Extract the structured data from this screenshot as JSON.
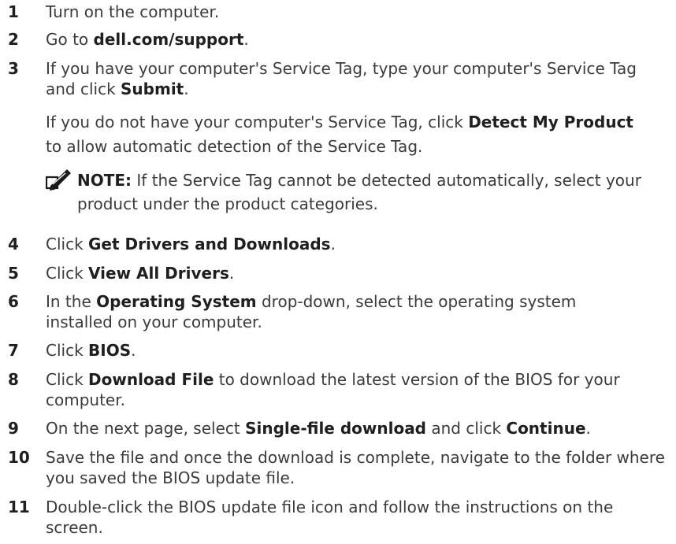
{
  "steps": [
    {
      "num": "1",
      "parts": [
        {
          "t": "Turn on the computer.",
          "b": false
        }
      ]
    },
    {
      "num": "2",
      "parts": [
        {
          "t": "Go to ",
          "b": false
        },
        {
          "t": "dell.com/support",
          "b": true
        },
        {
          "t": ".",
          "b": false
        }
      ]
    },
    {
      "num": "3",
      "parts": [
        {
          "t": "If you have your computer's Service Tag, type your computer's Service Tag and click ",
          "b": false
        },
        {
          "t": "Submit",
          "b": true
        },
        {
          "t": ".",
          "b": false
        }
      ]
    },
    {
      "num": "4",
      "parts": [
        {
          "t": "Click ",
          "b": false
        },
        {
          "t": "Get Drivers and Downloads",
          "b": true
        },
        {
          "t": ".",
          "b": false
        }
      ]
    },
    {
      "num": "5",
      "parts": [
        {
          "t": "Click ",
          "b": false
        },
        {
          "t": "View All Drivers",
          "b": true
        },
        {
          "t": ".",
          "b": false
        }
      ]
    },
    {
      "num": "6",
      "parts": [
        {
          "t": "In the ",
          "b": false
        },
        {
          "t": "Operating System",
          "b": true
        },
        {
          "t": " drop-down, select the operating system installed on your computer.",
          "b": false
        }
      ]
    },
    {
      "num": "7",
      "parts": [
        {
          "t": "Click ",
          "b": false
        },
        {
          "t": "BIOS",
          "b": true
        },
        {
          "t": ".",
          "b": false
        }
      ]
    },
    {
      "num": "8",
      "parts": [
        {
          "t": "Click ",
          "b": false
        },
        {
          "t": "Download File",
          "b": true
        },
        {
          "t": " to download the latest version of the BIOS for your computer.",
          "b": false
        }
      ]
    },
    {
      "num": "9",
      "parts": [
        {
          "t": "On the next page, select ",
          "b": false
        },
        {
          "t": "Single-file download",
          "b": true
        },
        {
          "t": " and click ",
          "b": false
        },
        {
          "t": "Continue",
          "b": true
        },
        {
          "t": ".",
          "b": false
        }
      ]
    },
    {
      "num": "10",
      "parts": [
        {
          "t": "Save the file and once the download is complete, navigate to the folder where you saved the BIOS update file.",
          "b": false
        }
      ]
    },
    {
      "num": "11",
      "parts": [
        {
          "t": "Double-click the BIOS update file icon and follow the instructions on the screen.",
          "b": false
        }
      ]
    }
  ],
  "step3_extra": [
    {
      "t": "If you do not have your computer's Service Tag, click ",
      "b": false
    },
    {
      "t": "Detect My Product",
      "b": true
    },
    {
      "t": " to allow automatic detection of the Service Tag.",
      "b": false
    }
  ],
  "note": {
    "label": "NOTE:",
    "text": " If the Service Tag cannot be detected automatically, select your product under the product categories.",
    "icon": "note-pencil-icon"
  }
}
